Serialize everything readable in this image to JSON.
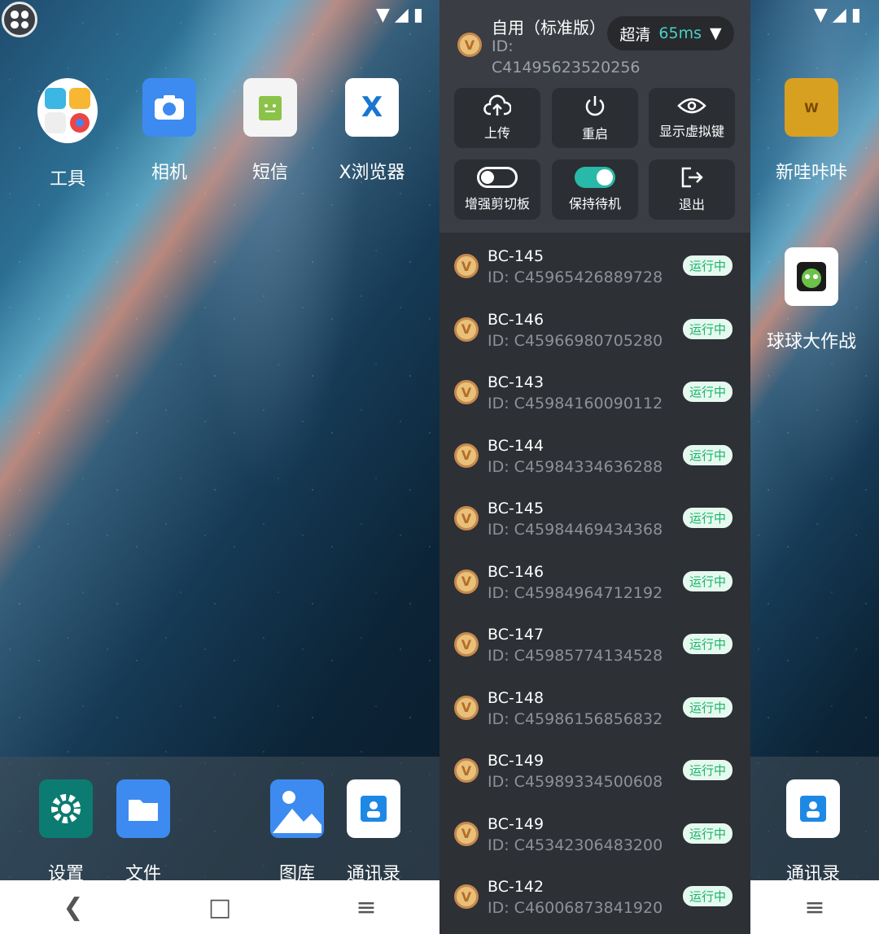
{
  "left_screen": {
    "apps": [
      {
        "label": "工具",
        "icon": "tools-folder-icon"
      },
      {
        "label": "相机",
        "icon": "camera-icon"
      },
      {
        "label": "短信",
        "icon": "sms-icon"
      },
      {
        "label": "X浏览器",
        "icon": "x-browser-icon"
      }
    ],
    "dock": [
      {
        "label": "设置",
        "icon": "settings-gear-icon"
      },
      {
        "label": "文件",
        "icon": "folder-icon"
      },
      {
        "label": "图库",
        "icon": "gallery-icon"
      },
      {
        "label": "通讯录",
        "icon": "contacts-icon"
      }
    ]
  },
  "right_screen": {
    "apps": [
      {
        "label": "新哇咔咔",
        "icon": "wakaka-icon"
      },
      {
        "label": "球球大作战",
        "icon": "ball-game-icon"
      }
    ],
    "dock": [
      {
        "label": "通讯录",
        "icon": "contacts-icon"
      }
    ]
  },
  "nav": {
    "back": "❮",
    "home": "□",
    "menu": "≡"
  },
  "panel": {
    "title": "自用（标准版）",
    "id_label": "ID:  C41495623520256",
    "quality": "超清",
    "latency": "65ms",
    "buttons": [
      {
        "label": "上传",
        "icon": "upload-cloud-icon"
      },
      {
        "label": "重启",
        "icon": "power-icon"
      },
      {
        "label": "显示虚拟键",
        "icon": "eye-icon"
      },
      {
        "label": "增强剪切板",
        "icon": "toggle-off"
      },
      {
        "label": "保持待机",
        "icon": "toggle-on"
      },
      {
        "label": "退出",
        "icon": "exit-icon"
      }
    ],
    "devices": [
      {
        "name": "BC-145",
        "id": "ID:  C45965426889728",
        "status": "运行中"
      },
      {
        "name": "BC-146",
        "id": "ID:  C45966980705280",
        "status": "运行中"
      },
      {
        "name": "BC-143",
        "id": "ID:  C45984160090112",
        "status": "运行中"
      },
      {
        "name": "BC-144",
        "id": "ID:  C45984334636288",
        "status": "运行中"
      },
      {
        "name": "BC-145",
        "id": "ID:  C45984469434368",
        "status": "运行中"
      },
      {
        "name": "BC-146",
        "id": "ID:  C45984964712192",
        "status": "运行中"
      },
      {
        "name": "BC-147",
        "id": "ID:  C45985774134528",
        "status": "运行中"
      },
      {
        "name": "BC-148",
        "id": "ID:  C45986156856832",
        "status": "运行中"
      },
      {
        "name": "BC-149",
        "id": "ID:  C45989334500608",
        "status": "运行中"
      },
      {
        "name": "BC-149",
        "id": "ID:  C45342306483200",
        "status": "运行中"
      },
      {
        "name": "BC-142",
        "id": "ID:  C46006873841920",
        "status": "运行中"
      }
    ]
  }
}
